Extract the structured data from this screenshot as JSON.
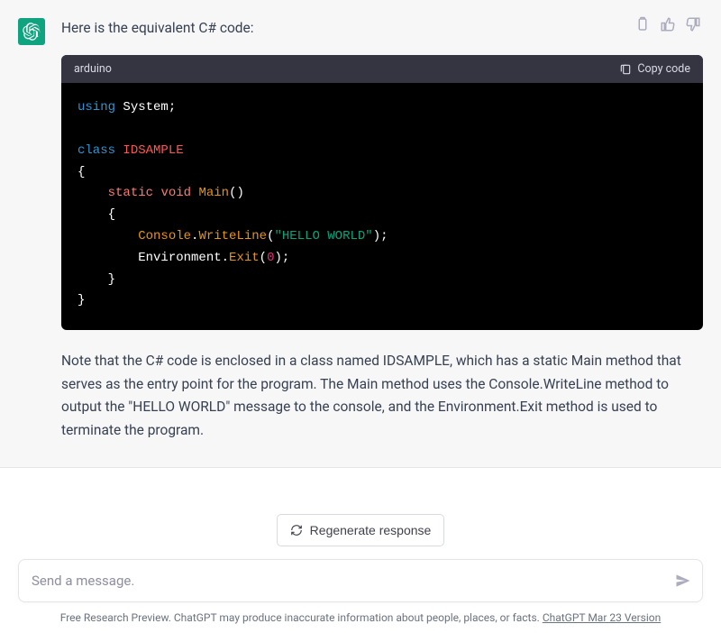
{
  "message": {
    "intro": "Here is the equivalent C# code:",
    "explanation": "Note that the C# code is enclosed in a class named IDSAMPLE, which has a static Main method that serves as the entry point for the program. The Main method uses the Console.WriteLine method to output the \"HELLO WORLD\" message to the console, and the Environment.Exit method is used to terminate the program."
  },
  "code": {
    "language": "arduino",
    "copy_label": "Copy code",
    "tokens": {
      "using": "using",
      "system": "System",
      "class_kw": "class",
      "class_name": "IDSAMPLE",
      "static": "static",
      "void": "void",
      "main": "Main",
      "console": "Console",
      "writeline": "WriteLine",
      "hello": "\"HELLO WORLD\"",
      "environment": "Environment",
      "exit": "Exit",
      "zero": "0"
    }
  },
  "controls": {
    "regenerate": "Regenerate response",
    "placeholder": "Send a message."
  },
  "footer": {
    "preview": "Free Research Preview. ChatGPT may produce inaccurate information about people, places, or facts. ",
    "version": "ChatGPT Mar 23 Version"
  }
}
